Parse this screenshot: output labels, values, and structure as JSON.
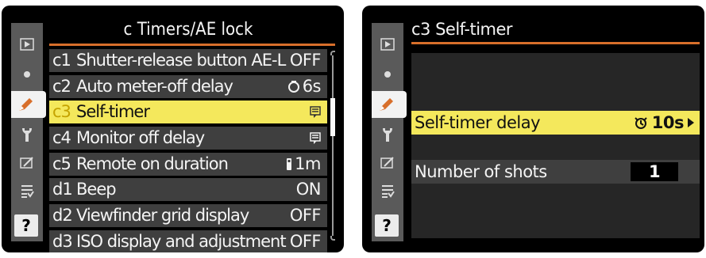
{
  "left_screen": {
    "title": "c Timers/AE lock",
    "items": [
      {
        "code": "c1",
        "label": "Shutter-release button AE-L",
        "value": "OFF",
        "icon": ""
      },
      {
        "code": "c2",
        "label": "Auto meter-off delay",
        "value": "6s",
        "icon": "meter-off-timer-icon"
      },
      {
        "code": "c3",
        "label": "Self-timer",
        "value": "",
        "icon": "self-timer-menu-icon"
      },
      {
        "code": "c4",
        "label": "Monitor off delay",
        "value": "",
        "icon": "monitor-menu-icon"
      },
      {
        "code": "c5",
        "label": "Remote on duration",
        "value": "1m",
        "icon": "remote-icon"
      },
      {
        "code": "d1",
        "label": "Beep",
        "value": "ON",
        "icon": ""
      },
      {
        "code": "d2",
        "label": "Viewfinder grid display",
        "value": "OFF",
        "icon": ""
      },
      {
        "code": "d3",
        "label": "ISO display and adjustment",
        "value": "OFF",
        "icon": ""
      }
    ],
    "selected_index": 2
  },
  "right_screen": {
    "title": "c3 Self-timer",
    "items": [
      {
        "label": "Self-timer delay",
        "value": "10s",
        "icon": "self-timer-icon"
      },
      {
        "label": "Number of shots",
        "value": "1"
      }
    ]
  },
  "tabs": [
    "playback-menu-icon",
    "shooting-menu-icon",
    "custom-settings-pencil-icon",
    "setup-wrench-icon",
    "retouch-menu-icon",
    "recent-settings-icon"
  ],
  "help": "?",
  "colors": {
    "accent": "#d86f2b",
    "highlight": "#f4e85c",
    "row_bg": "#3f3f3f",
    "tab_bg": "#5a5a5a"
  }
}
